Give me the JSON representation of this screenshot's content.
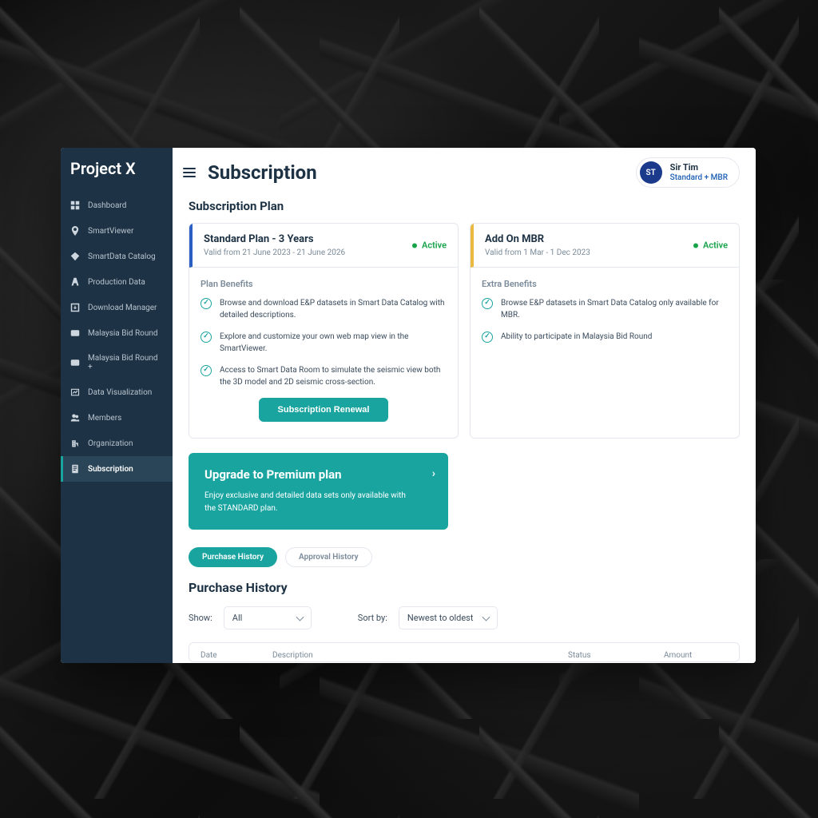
{
  "app_name": "Project X",
  "page_title": "Subscription",
  "user": {
    "initials": "ST",
    "name": "Sir Tim",
    "plan_label": "Standard + MBR"
  },
  "section_title": "Subscription Plan",
  "sidebar": {
    "items": [
      {
        "label": "Dashboard"
      },
      {
        "label": "SmartViewer"
      },
      {
        "label": "SmartData Catalog"
      },
      {
        "label": "Production Data"
      },
      {
        "label": "Download Manager"
      },
      {
        "label": "Malaysia Bid Round"
      },
      {
        "label": "Malaysia Bid Round +"
      },
      {
        "label": "Data Visualization"
      },
      {
        "label": "Members"
      },
      {
        "label": "Organization"
      },
      {
        "label": "Subscription"
      }
    ]
  },
  "plans": {
    "standard": {
      "name": "Standard Plan - 3 Years",
      "valid": "Valid from 21 June 2023 - 21 June 2026",
      "status": "Active",
      "benefits_label": "Plan Benefits",
      "benefits": [
        "Browse and download E&P datasets in Smart Data Catalog with detailed descriptions.",
        "Explore and customize your own web map view in the SmartViewer.",
        "Access to Smart Data Room to simulate the seismic view both the 3D model and 2D seismic cross-section."
      ],
      "renew_label": "Subscription Renewal"
    },
    "addon": {
      "name": "Add On MBR",
      "valid": "Valid from 1 Mar - 1 Dec 2023",
      "status": "Active",
      "benefits_label": "Extra Benefits",
      "benefits": [
        "Browse E&P datasets in Smart Data Catalog only available for MBR.",
        "Ability to participate in Malaysia Bid Round"
      ]
    }
  },
  "upgrade": {
    "title": "Upgrade to Premium plan",
    "subtitle": "Enjoy exclusive and detailed data sets only available with the STANDARD plan."
  },
  "tabs": {
    "purchase": "Purchase History",
    "approval": "Approval History"
  },
  "history": {
    "title": "Purchase History",
    "show_label": "Show:",
    "show_value": "All",
    "sort_label": "Sort by:",
    "sort_value": "Newest to oldest",
    "columns": {
      "date": "Date",
      "description": "Description",
      "status": "Status",
      "amount": "Amount"
    }
  },
  "colors": {
    "sidebar_bg": "#1d3244",
    "accent": "#1aa4a0",
    "blue_accent": "#2b5fc3",
    "yellow_accent": "#eab940",
    "active_green": "#16a34a"
  }
}
